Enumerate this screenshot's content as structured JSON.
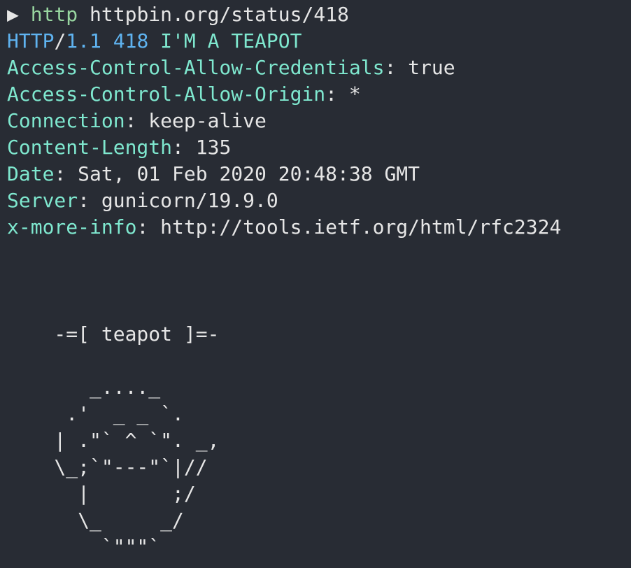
{
  "command": {
    "prompt": "▶",
    "program": "http",
    "url": "httpbin.org/status/418"
  },
  "status_line": {
    "protocol": "HTTP",
    "slash": "/",
    "version": "1.1",
    "code": "418",
    "reason": "I'M A TEAPOT"
  },
  "headers": [
    {
      "name": "Access-Control-Allow-Credentials",
      "value": "true"
    },
    {
      "name": "Access-Control-Allow-Origin",
      "value": "*"
    },
    {
      "name": "Connection",
      "value": "keep-alive"
    },
    {
      "name": "Content-Length",
      "value": "135"
    },
    {
      "name": "Date",
      "value": "Sat, 01 Feb 2020 20:48:38 GMT"
    },
    {
      "name": "Server",
      "value": "gunicorn/19.9.0"
    },
    {
      "name": "x-more-info",
      "value": "http://tools.ietf.org/html/rfc2324"
    }
  ],
  "separator": ": ",
  "body_art": "\n    -=[ teapot ]=-\n\n       _...._\n     .'  _ _ `.\n    | .\"` ^ `\". _,\n    \\_;`\"---\"`|//\n      |       ;/\n      \\_     _/\n        `\"\"\"`"
}
